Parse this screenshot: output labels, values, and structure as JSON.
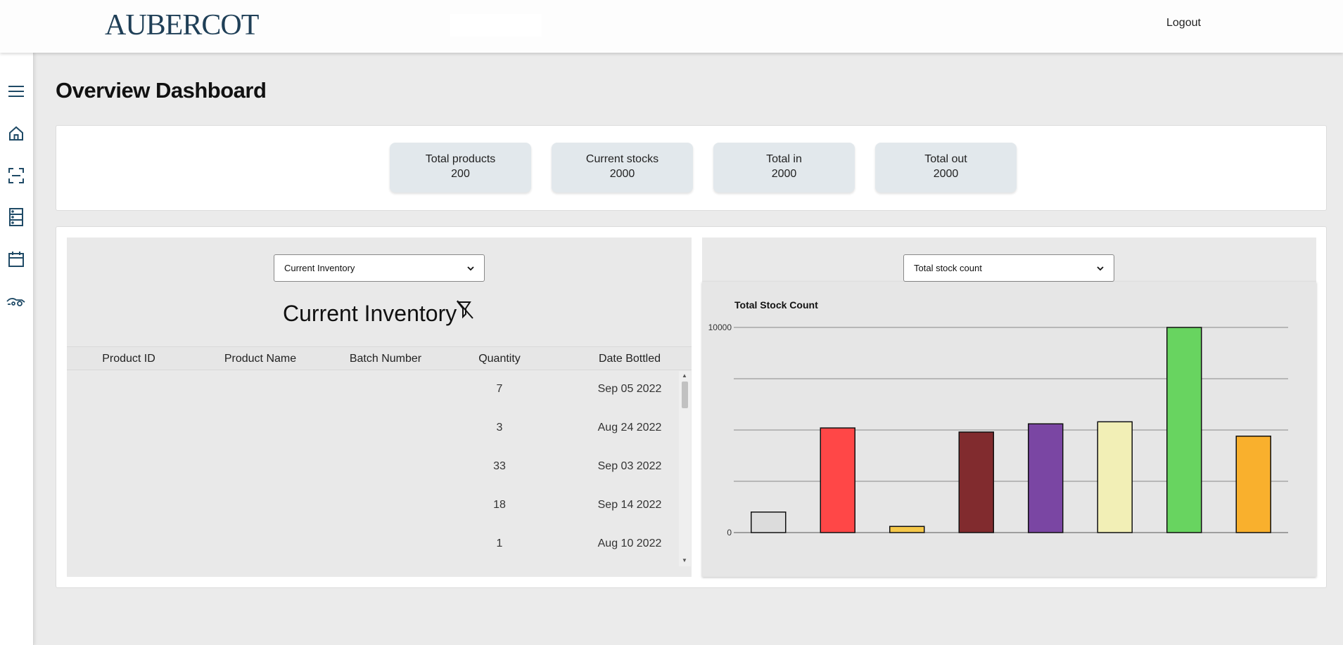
{
  "header": {
    "logo": "AUBERCOT",
    "logout": "Logout"
  },
  "sidebar": {
    "items": [
      {
        "name": "menu-icon"
      },
      {
        "name": "home-icon"
      },
      {
        "name": "scan-icon"
      },
      {
        "name": "inventory-icon"
      },
      {
        "name": "calendar-icon"
      },
      {
        "name": "delivery-icon"
      }
    ]
  },
  "page_title": "Overview Dashboard",
  "stats": [
    {
      "label": "Total products",
      "value": "200"
    },
    {
      "label": "Current stocks",
      "value": "2000"
    },
    {
      "label": "Total in",
      "value": "2000"
    },
    {
      "label": "Total out",
      "value": "2000"
    }
  ],
  "inventory": {
    "select_value": "Current Inventory",
    "title": "Current Inventory",
    "columns": [
      "Product ID",
      "Product Name",
      "Batch Number",
      "Quantity",
      "Date Bottled"
    ],
    "rows": [
      {
        "product_id": "",
        "product_name": "",
        "batch_number": "",
        "quantity": "7",
        "date_bottled": "Sep 05 2022"
      },
      {
        "product_id": "",
        "product_name": "",
        "batch_number": "",
        "quantity": "3",
        "date_bottled": "Aug 24 2022"
      },
      {
        "product_id": "",
        "product_name": "",
        "batch_number": "",
        "quantity": "33",
        "date_bottled": "Sep 03 2022"
      },
      {
        "product_id": "",
        "product_name": "",
        "batch_number": "",
        "quantity": "18",
        "date_bottled": "Sep 14 2022"
      },
      {
        "product_id": "",
        "product_name": "",
        "batch_number": "",
        "quantity": "1",
        "date_bottled": "Aug 10 2022"
      }
    ]
  },
  "chart_panel": {
    "select_value": "Total stock count"
  },
  "chart_data": {
    "type": "bar",
    "title": "Total Stock Count",
    "xlabel": "",
    "ylabel": "",
    "ylim": [
      0,
      10000
    ],
    "ytick_labels": [
      "0",
      "10000"
    ],
    "grid": true,
    "categories": [
      "",
      "",
      "",
      "",
      "",
      "",
      "",
      ""
    ],
    "values": [
      1000,
      5100,
      300,
      4900,
      5300,
      5400,
      10000,
      4700
    ],
    "colors": [
      "#dcdcdc",
      "#ff4747",
      "#f5c84a",
      "#812b2e",
      "#7a46a3",
      "#f2efb6",
      "#68d460",
      "#f9b02d"
    ]
  }
}
